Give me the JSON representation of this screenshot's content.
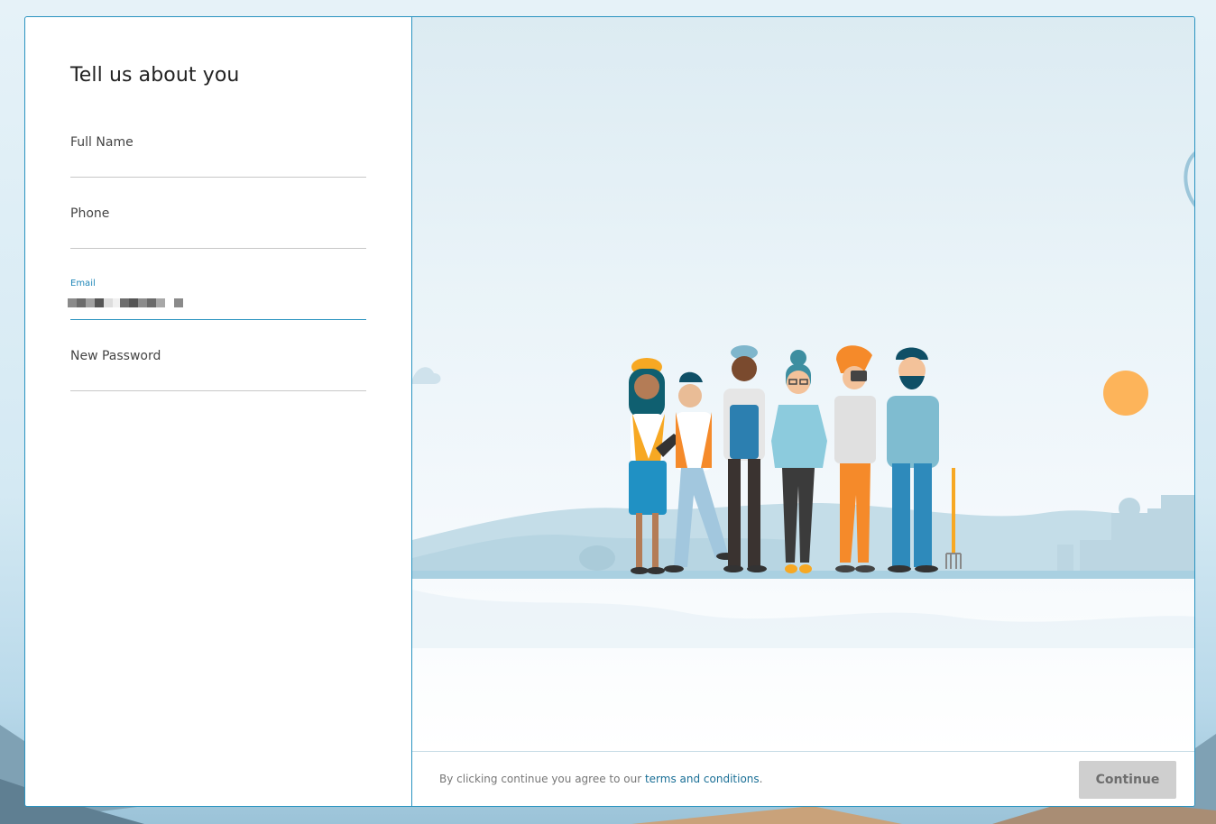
{
  "form": {
    "title": "Tell us about you",
    "fields": {
      "full_name": {
        "label": "Full Name",
        "value": ""
      },
      "phone": {
        "label": "Phone",
        "value": ""
      },
      "email": {
        "label": "Email",
        "value": "[redacted]"
      },
      "new_password": {
        "label": "New Password",
        "value": ""
      }
    }
  },
  "footer": {
    "agree_text": "By clicking continue you agree to our ",
    "terms_link": "terms and conditions",
    "terms_suffix": ".",
    "continue_label": "Continue"
  },
  "colors": {
    "accent": "#2a93c0",
    "link": "#1a6f96",
    "button_disabled": "#cfcfcf"
  }
}
